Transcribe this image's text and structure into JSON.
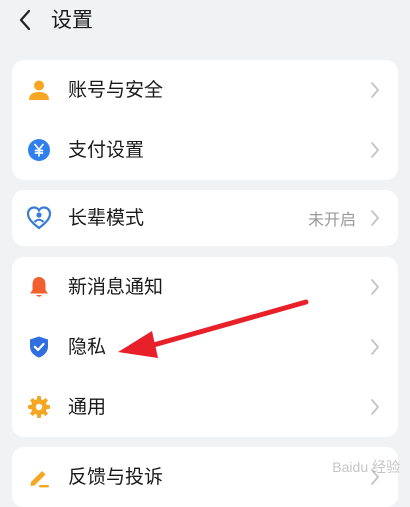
{
  "header": {
    "title": "设置",
    "back_icon": "chevron-left-icon"
  },
  "groups": [
    {
      "items": [
        {
          "label": "账号与安全",
          "icon": "person-icon",
          "color": "#f5a623"
        },
        {
          "label": "支付设置",
          "icon": "yuan-icon",
          "color": "#2f80ed"
        }
      ]
    },
    {
      "items": [
        {
          "label": "长辈模式",
          "value": "未开启",
          "icon": "heart-person-icon",
          "color": "#3a7bd5"
        }
      ]
    },
    {
      "items": [
        {
          "label": "新消息通知",
          "icon": "bell-icon",
          "color": "#f2602f"
        },
        {
          "label": "隐私",
          "icon": "shield-icon",
          "color": "#2f6fe0"
        },
        {
          "label": "通用",
          "icon": "gear-icon",
          "color": "#f5a623"
        }
      ]
    },
    {
      "items": [
        {
          "label": "反馈与投诉",
          "icon": "edit-icon",
          "color": "#f5a623"
        }
      ]
    }
  ],
  "annotation": {
    "color": "#e8202a"
  },
  "watermark": {
    "text": "Baidu 经验"
  }
}
